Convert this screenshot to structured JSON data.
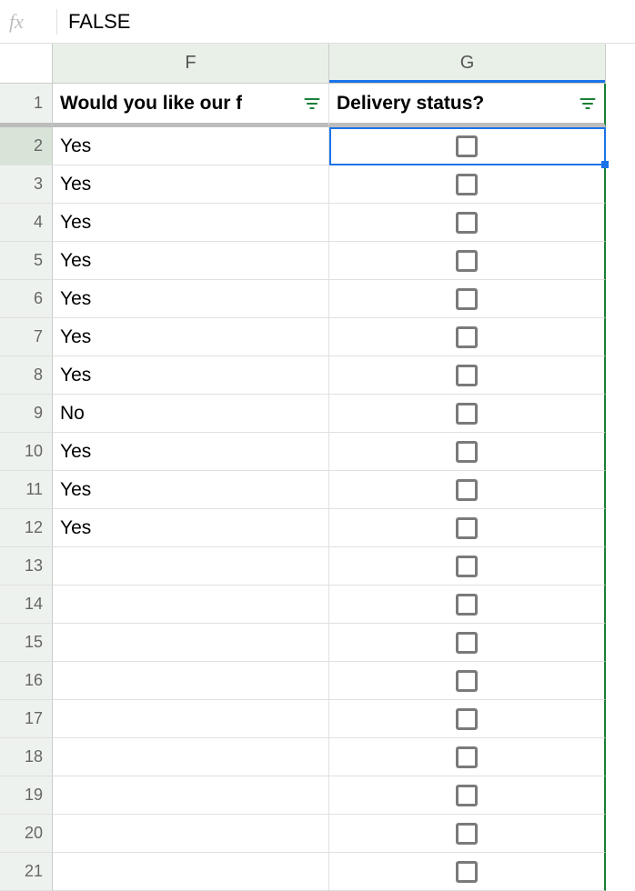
{
  "formula_bar": {
    "fx_label": "fx",
    "value": "FALSE"
  },
  "columns": [
    {
      "letter": "F",
      "label": "Would you like our f"
    },
    {
      "letter": "G",
      "label": "Delivery status?"
    }
  ],
  "selected_cell": {
    "row": 2,
    "col": "G"
  },
  "chart_data": {
    "type": "table",
    "columns": [
      "Row",
      "Would you like our f",
      "Delivery status?"
    ],
    "rows": [
      {
        "row": 2,
        "f": "Yes",
        "g": false
      },
      {
        "row": 3,
        "f": "Yes",
        "g": false
      },
      {
        "row": 4,
        "f": "Yes",
        "g": false
      },
      {
        "row": 5,
        "f": "Yes",
        "g": false
      },
      {
        "row": 6,
        "f": "Yes",
        "g": false
      },
      {
        "row": 7,
        "f": "Yes",
        "g": false
      },
      {
        "row": 8,
        "f": "Yes",
        "g": false
      },
      {
        "row": 9,
        "f": "No",
        "g": false
      },
      {
        "row": 10,
        "f": "Yes",
        "g": false
      },
      {
        "row": 11,
        "f": "Yes",
        "g": false
      },
      {
        "row": 12,
        "f": "Yes",
        "g": false
      },
      {
        "row": 13,
        "f": "",
        "g": false
      },
      {
        "row": 14,
        "f": "",
        "g": false
      },
      {
        "row": 15,
        "f": "",
        "g": false
      },
      {
        "row": 16,
        "f": "",
        "g": false
      },
      {
        "row": 17,
        "f": "",
        "g": false
      },
      {
        "row": 18,
        "f": "",
        "g": false
      },
      {
        "row": 19,
        "f": "",
        "g": false
      },
      {
        "row": 20,
        "f": "",
        "g": false
      },
      {
        "row": 21,
        "f": "",
        "g": false
      }
    ]
  },
  "rows": [
    {
      "num": "1"
    },
    {
      "num": "2"
    },
    {
      "num": "3"
    },
    {
      "num": "4"
    },
    {
      "num": "5"
    },
    {
      "num": "6"
    },
    {
      "num": "7"
    },
    {
      "num": "8"
    },
    {
      "num": "9"
    },
    {
      "num": "10"
    },
    {
      "num": "11"
    },
    {
      "num": "12"
    },
    {
      "num": "13"
    },
    {
      "num": "14"
    },
    {
      "num": "15"
    },
    {
      "num": "16"
    },
    {
      "num": "17"
    },
    {
      "num": "18"
    },
    {
      "num": "19"
    },
    {
      "num": "20"
    },
    {
      "num": "21"
    }
  ]
}
